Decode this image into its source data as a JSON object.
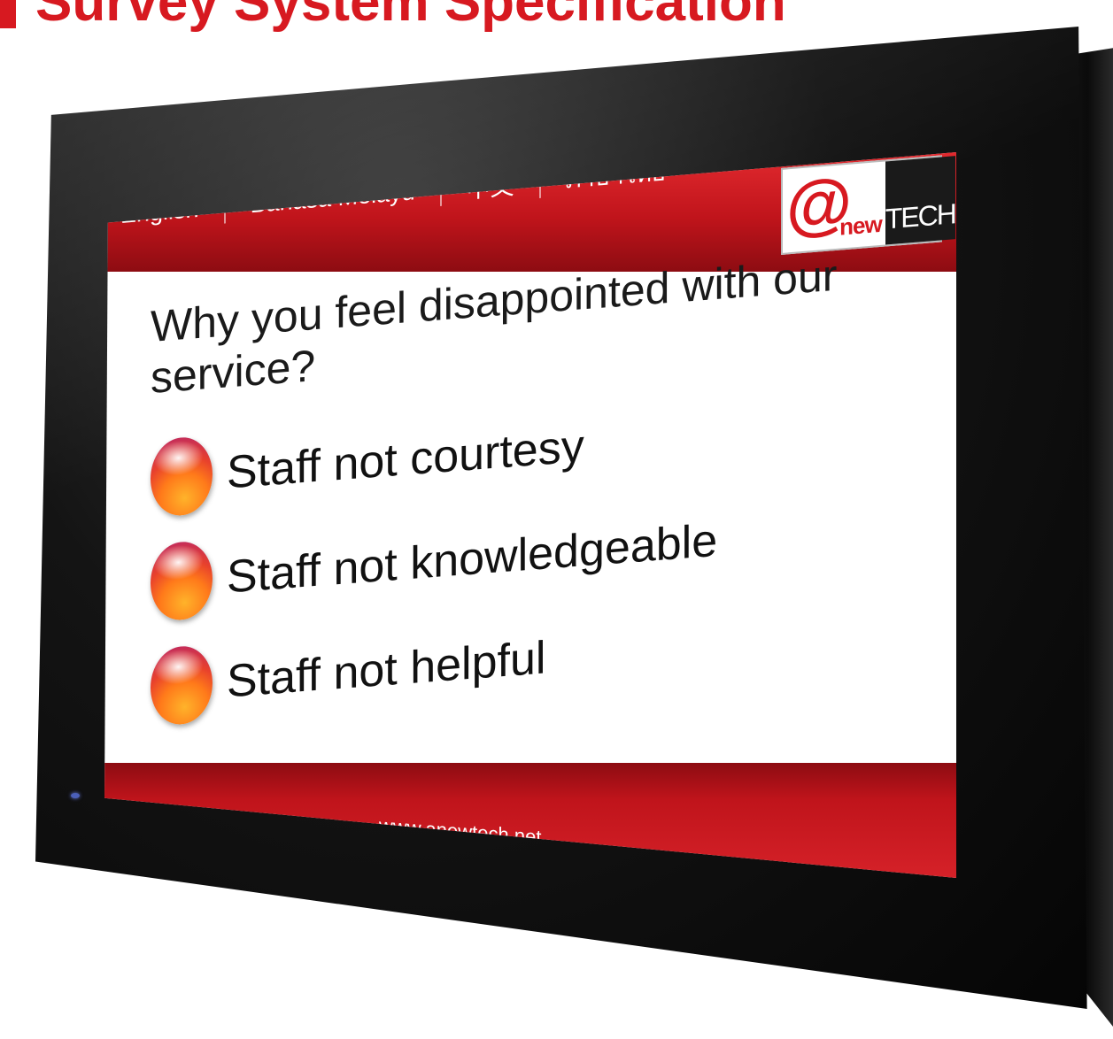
{
  "page": {
    "heading": "Survey System Specification"
  },
  "device": {
    "logo": {
      "at": "@",
      "new": "new",
      "tech": "TECH"
    }
  },
  "languages": {
    "items": [
      {
        "label": "English"
      },
      {
        "label": "Bahasa Melayu"
      },
      {
        "label": "中文"
      },
      {
        "label": "ภาษาไทย"
      }
    ]
  },
  "survey": {
    "question": "Why you feel disappointed with our service?",
    "options": [
      {
        "label": "Staff not courtesy"
      },
      {
        "label": "Staff not knowledgeable"
      },
      {
        "label": "Staff not helpful"
      }
    ]
  },
  "footer": {
    "url": "www.anewtech.net"
  },
  "colors": {
    "brand_red": "#d71920",
    "bezel": "#0b0b0b",
    "screen_bg": "#ffffff",
    "option_button": "#ff7a1a"
  },
  "icons": {
    "option_button": "glossy-orange-radio-button-icon"
  }
}
